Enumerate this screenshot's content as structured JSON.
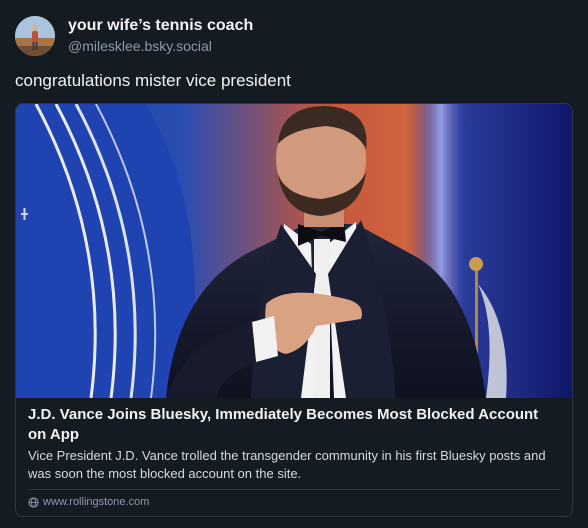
{
  "post": {
    "author": {
      "display_name": "your wife’s tennis coach",
      "handle": "@milesklee.bsky.social"
    },
    "text": "congratulations mister vice president",
    "link_card": {
      "title": "J.D. Vance Joins Bluesky, Immediately Becomes Most Blocked Account on App",
      "description": "Vice President J.D. Vance trolled the transgender community in his first Bluesky posts and was soon the most blocked account on the site.",
      "source": "www.rollingstone.com",
      "source_icon": "globe-icon"
    }
  },
  "colors": {
    "background": "#151b23",
    "text_primary": "#f1f3f5",
    "text_secondary": "#8d9aab",
    "border": "#2e3845"
  }
}
